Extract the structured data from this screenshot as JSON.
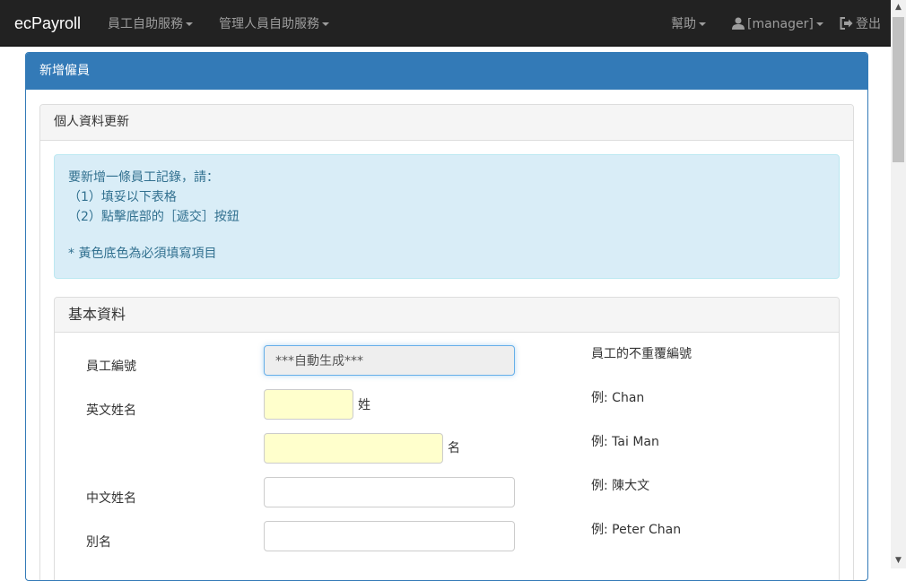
{
  "navbar": {
    "brand": "ecPayroll",
    "employee_self_service": "員工自助服務",
    "manager_self_service": "管理人員自助服務",
    "help": "幫助",
    "user": "[manager]",
    "logout": "登出"
  },
  "page": {
    "panel_title": "新增僱員",
    "section_title": "個人資料更新"
  },
  "instructions": {
    "lines": [
      "要新增一條員工記錄，請：",
      "（1）填妥以下表格",
      "（2）點擊底部的［遞交］按鈕"
    ],
    "note": "* 黃色底色為必須填寫項目"
  },
  "basic_info": {
    "title": "基本資料",
    "employee_no": {
      "label": "員工編號",
      "value": "***自動生成***",
      "hint": "員工的不重覆編號"
    },
    "english_name": {
      "label": "英文姓名",
      "surname_suffix": "姓",
      "surname_hint": "例: Chan",
      "given_suffix": "名",
      "given_hint": "例: Tai Man"
    },
    "chinese_name": {
      "label": "中文姓名",
      "hint": "例: 陳大文"
    },
    "alias": {
      "label": "別名",
      "hint": "例: Peter Chan"
    }
  }
}
